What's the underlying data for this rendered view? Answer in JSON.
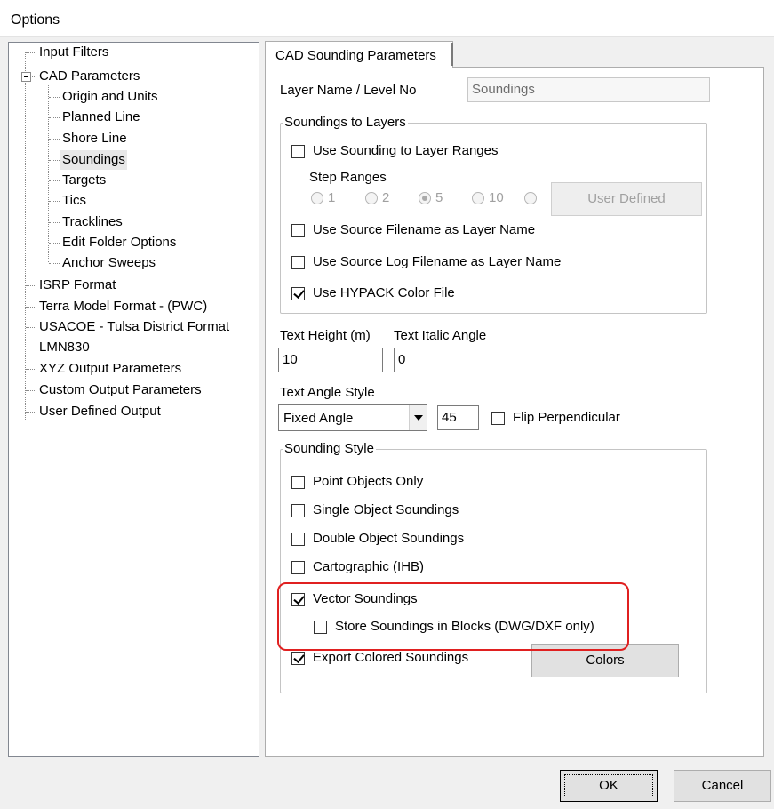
{
  "window": {
    "title": "Options"
  },
  "tree": {
    "items": [
      {
        "label": "Input Filters",
        "level": 0
      },
      {
        "label": "CAD Parameters",
        "level": 0,
        "expanded": true
      },
      {
        "label": "Origin and Units",
        "level": 1
      },
      {
        "label": "Planned Line",
        "level": 1
      },
      {
        "label": "Shore Line",
        "level": 1
      },
      {
        "label": "Soundings",
        "level": 1,
        "selected": true
      },
      {
        "label": "Targets",
        "level": 1
      },
      {
        "label": "Tics",
        "level": 1
      },
      {
        "label": "Tracklines",
        "level": 1
      },
      {
        "label": "Edit Folder Options",
        "level": 1
      },
      {
        "label": "Anchor Sweeps",
        "level": 1
      },
      {
        "label": "ISRP Format",
        "level": 0
      },
      {
        "label": "Terra Model Format - (PWC)",
        "level": 0
      },
      {
        "label": "USACOE - Tulsa District Format",
        "level": 0
      },
      {
        "label": "LMN830",
        "level": 0
      },
      {
        "label": "XYZ Output Parameters",
        "level": 0
      },
      {
        "label": "Custom Output Parameters",
        "level": 0
      },
      {
        "label": "User Defined Output",
        "level": 0
      }
    ]
  },
  "tab": {
    "label": "CAD Sounding Parameters"
  },
  "layer": {
    "label": "Layer Name / Level No",
    "value": "Soundings"
  },
  "layers_group": {
    "title": "Soundings to Layers",
    "use_ranges": {
      "label": "Use Sounding to Layer Ranges",
      "checked": false
    },
    "step_ranges_label": "Step Ranges",
    "radios": [
      {
        "label": "1",
        "selected": false
      },
      {
        "label": "2",
        "selected": false
      },
      {
        "label": "5",
        "selected": true
      },
      {
        "label": "10",
        "selected": false
      },
      {
        "label": "",
        "selected": false
      }
    ],
    "user_defined": "User Defined",
    "source_filename": {
      "label": "Use Source Filename as Layer Name",
      "checked": false
    },
    "source_log": {
      "label": "Use Source Log Filename as Layer Name",
      "checked": false
    },
    "hypack_color": {
      "label": "Use HYPACK Color File",
      "checked": true
    }
  },
  "text": {
    "height_label": "Text Height (m)",
    "height_value": "10",
    "italic_label": "Text Italic Angle",
    "italic_value": "0",
    "angle_style_label": "Text Angle Style",
    "angle_style_value": "Fixed Angle",
    "angle_value": "45",
    "flip": {
      "label": "Flip Perpendicular",
      "checked": false
    }
  },
  "style_group": {
    "title": "Sounding Style",
    "point_only": {
      "label": "Point Objects Only",
      "checked": false
    },
    "single_object": {
      "label": "Single Object Soundings",
      "checked": false
    },
    "double_object": {
      "label": "Double Object Soundings",
      "checked": false
    },
    "cartographic": {
      "label": "Cartographic (IHB)",
      "checked": false
    },
    "vector": {
      "label": "Vector Soundings",
      "checked": true
    },
    "store_blocks": {
      "label": "Store Soundings in Blocks (DWG/DXF only)",
      "checked": false
    },
    "export_colored": {
      "label": "Export Colored Soundings",
      "checked": true
    },
    "colors_button": "Colors"
  },
  "footer": {
    "ok": "OK",
    "cancel": "Cancel"
  },
  "colors": {
    "highlight": "#e02020",
    "window_bg": "#f0f0f0",
    "page_bg": "#ffffff"
  }
}
